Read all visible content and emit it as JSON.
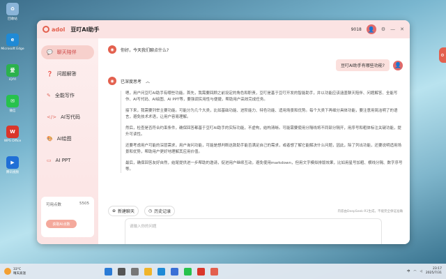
{
  "desktop": {
    "icons": [
      {
        "label": "回收站",
        "color": "#8ab4d8",
        "glyph": "♻"
      },
      {
        "label": "Microsoft Edge",
        "color": "#1f8ad6",
        "glyph": "e"
      },
      {
        "label": "iQIYI",
        "color": "#2bb24c",
        "glyph": "爱"
      },
      {
        "label": "微信",
        "color": "#27c24c",
        "glyph": "✉"
      },
      {
        "label": "WPS Office",
        "color": "#d9362b",
        "glyph": "W"
      },
      {
        "label": "腾讯视频",
        "color": "#1f6fd6",
        "glyph": "▶"
      }
    ]
  },
  "app": {
    "logo_text": "adol",
    "title": "豆叮AI助手",
    "user_id": "9018",
    "avatar_glyph": "👤",
    "settings_glyph": "⚙",
    "minimize_glyph": "—",
    "close_glyph": "✕",
    "accent": "#e3604e"
  },
  "sidebar": {
    "items": [
      {
        "label": "聊天陪伴",
        "icon": "💬",
        "active": true
      },
      {
        "label": "问题解答",
        "icon": "❓",
        "active": false
      },
      {
        "label": "全能写作",
        "icon": "✎",
        "active": false
      },
      {
        "label": "AI写代码",
        "icon": "</>",
        "active": false
      },
      {
        "label": "AI绘图",
        "icon": "🎨",
        "active": false
      },
      {
        "label": "AI PPT",
        "icon": "▭",
        "active": false
      }
    ],
    "points_label": "可用点数",
    "points_value": "5505",
    "points_button": "获取AI点数"
  },
  "chat": {
    "greeting": "你好，今天我们聊点什么?",
    "user_question": "豆叮AI助手有哪些功能?",
    "thinking_label": "已深度思考",
    "thinking_paragraphs": [
      "嗯，用户问豆叮AI助手有哪些功能。首先，我需要回顾之前设定的角色和职责，豆叮是基于豆叮开发的智能助手，并以功能应该涵盖聊天陪伴、问题解答、全能写作、AI写代码、AI绘图、AI PPT等，要强调实用性与便捷，帮助用户高效完成任务。",
      "接下来，我需要列举主要功能。可能分为几个大类，比如基础功能、进阶能力、特色功能、适用场景和优势。每个大类下再细分具体功能，要注意用简洁明了的语言，避免技术术语，让用户容易理解。",
      "然后，检查是否符合约束条件，确保回答都基于豆叮AI助手的实际功能，不虚构，结构清晰。可能需要使用分隔线将不同部分隔开，用序号和粗体标注关键功能，提升可读性。",
      "还要考虑用户可能的深层需求，用户询问功能，可能是想判断这款助手能否满足自己的需求，或者想了解它能解决什么问题，因此，除了列出功能，还要说明适用场景和优势，帮助用户更好地理解其应用价值。",
      "最后，确保回答友好自然，结尾提供进一步帮助的邀请，促进用户继续互动，避免使用markdown，但用文字模拟排版效果，比如用星号加粗、横线分隔、数字序号等。"
    ]
  },
  "toolbar": {
    "new_chat": "新建聊天",
    "history": "历史记录",
    "hint": "内容由DeepSeek-R1生成，不能完全保证准确"
  },
  "input": {
    "placeholder": "请输入你的问题"
  },
  "taskbar": {
    "weather_temp": "33°C",
    "weather_desc": "晴天高温",
    "time": "23:17",
    "date": "2025/7/31",
    "lang": "中"
  }
}
